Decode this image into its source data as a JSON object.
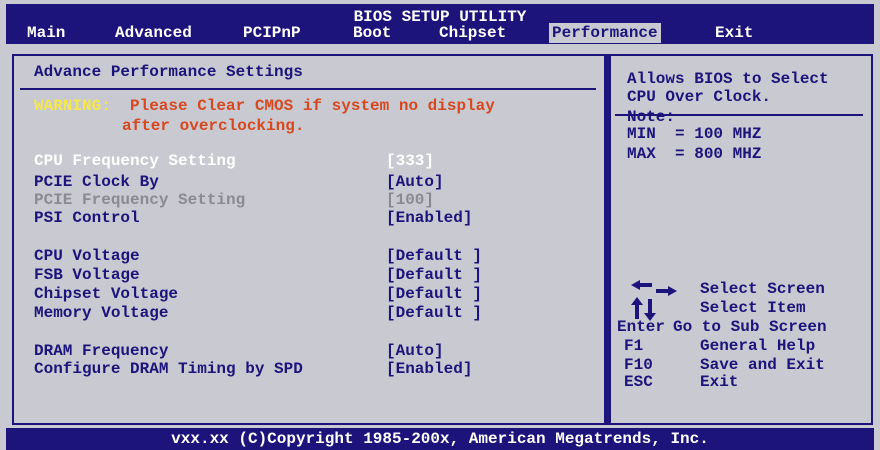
{
  "title": "BIOS SETUP UTILITY",
  "menu": [
    "Main",
    "Advanced",
    "PCIPnP",
    "Boot",
    "Chipset",
    "Performance",
    "Exit"
  ],
  "active_menu": "Performance",
  "section_title": "Advance Performance Settings",
  "warning": {
    "prefix": "WARNING:",
    "line1": "Please Clear CMOS if system no display",
    "line2": "after overclocking."
  },
  "settings": [
    {
      "label": "CPU Frequency Setting",
      "value": "[333]",
      "state": "selected"
    },
    {
      "label": "PCIE Clock By",
      "value": "[Auto]",
      "state": "normal"
    },
    {
      "label": "PCIE Frequency Setting",
      "value": "[100]",
      "state": "disabled"
    },
    {
      "label": "PSI Control",
      "value": "[Enabled]",
      "state": "normal"
    },
    {
      "label": "CPU Voltage",
      "value": "[Default ]",
      "state": "normal"
    },
    {
      "label": "FSB Voltage",
      "value": "[Default ]",
      "state": "normal"
    },
    {
      "label": "Chipset Voltage",
      "value": "[Default ]",
      "state": "normal"
    },
    {
      "label": "Memory Voltage",
      "value": "[Default ]",
      "state": "normal"
    },
    {
      "label": "DRAM Frequency",
      "value": "[Auto]",
      "state": "normal"
    },
    {
      "label": "Configure DRAM Timing by SPD",
      "value": "[Enabled]",
      "state": "normal"
    }
  ],
  "help": {
    "lines": [
      "Allows BIOS to Select",
      "CPU Over Clock."
    ],
    "note_label": "Note:",
    "min": "MIN  = 100 MHZ",
    "max": "MAX  = 800 MHZ"
  },
  "key_legend": [
    {
      "key": "",
      "icon": "left-right-arrows-icon",
      "action": "Select Screen"
    },
    {
      "key": "",
      "icon": "up-down-arrows-icon",
      "action": "Select Item"
    },
    {
      "key": "Enter",
      "icon": "",
      "action": "Go to Sub Screen"
    },
    {
      "key": "F1",
      "icon": "",
      "action": "General Help"
    },
    {
      "key": "F10",
      "icon": "",
      "action": "Save and Exit"
    },
    {
      "key": "ESC",
      "icon": "",
      "action": "Exit"
    }
  ],
  "copyright": "vxx.xx (C)Copyright 1985-200x, American Megatrends, Inc.",
  "colors": {
    "background": "#c9c9d2",
    "navy": "#1c147a",
    "highlight_white": "#ffffff",
    "disabled_grey": "#8a8a95",
    "warning_red": "#d8481e",
    "warning_yellow": "#f5e84a"
  }
}
